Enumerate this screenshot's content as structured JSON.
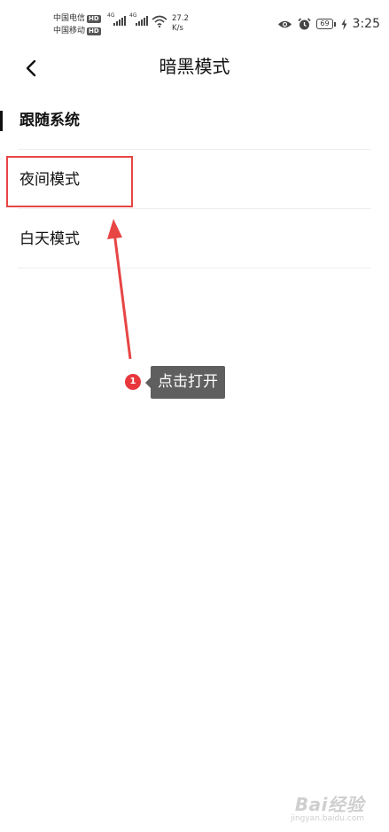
{
  "status_bar": {
    "carrier_1": "中国电信",
    "carrier_2": "中国移动",
    "hd_badge": "HD",
    "signal_1_label": "4G",
    "signal_2_label": "4G",
    "speed_value": "27.2",
    "speed_unit": "K/s",
    "battery_level": "69",
    "time": "3:25",
    "eye_icon": "eye-icon",
    "alarm_icon": "alarm-icon",
    "charging_icon": "charging-bolt-icon"
  },
  "header": {
    "back_icon": "chevron-left-icon",
    "title": "暗黑模式"
  },
  "options": [
    {
      "label": "跟随系统",
      "selected": true
    },
    {
      "label": "夜间模式",
      "selected": false
    },
    {
      "label": "白天模式",
      "selected": false
    }
  ],
  "annotation": {
    "step_number": "1",
    "tooltip_text": "点击打开",
    "accent_color": "#e84545",
    "tooltip_color": "#5f5f5f"
  },
  "watermark": {
    "logo_text": "Bai经验",
    "url_text": "jingyan.baidu.com"
  }
}
